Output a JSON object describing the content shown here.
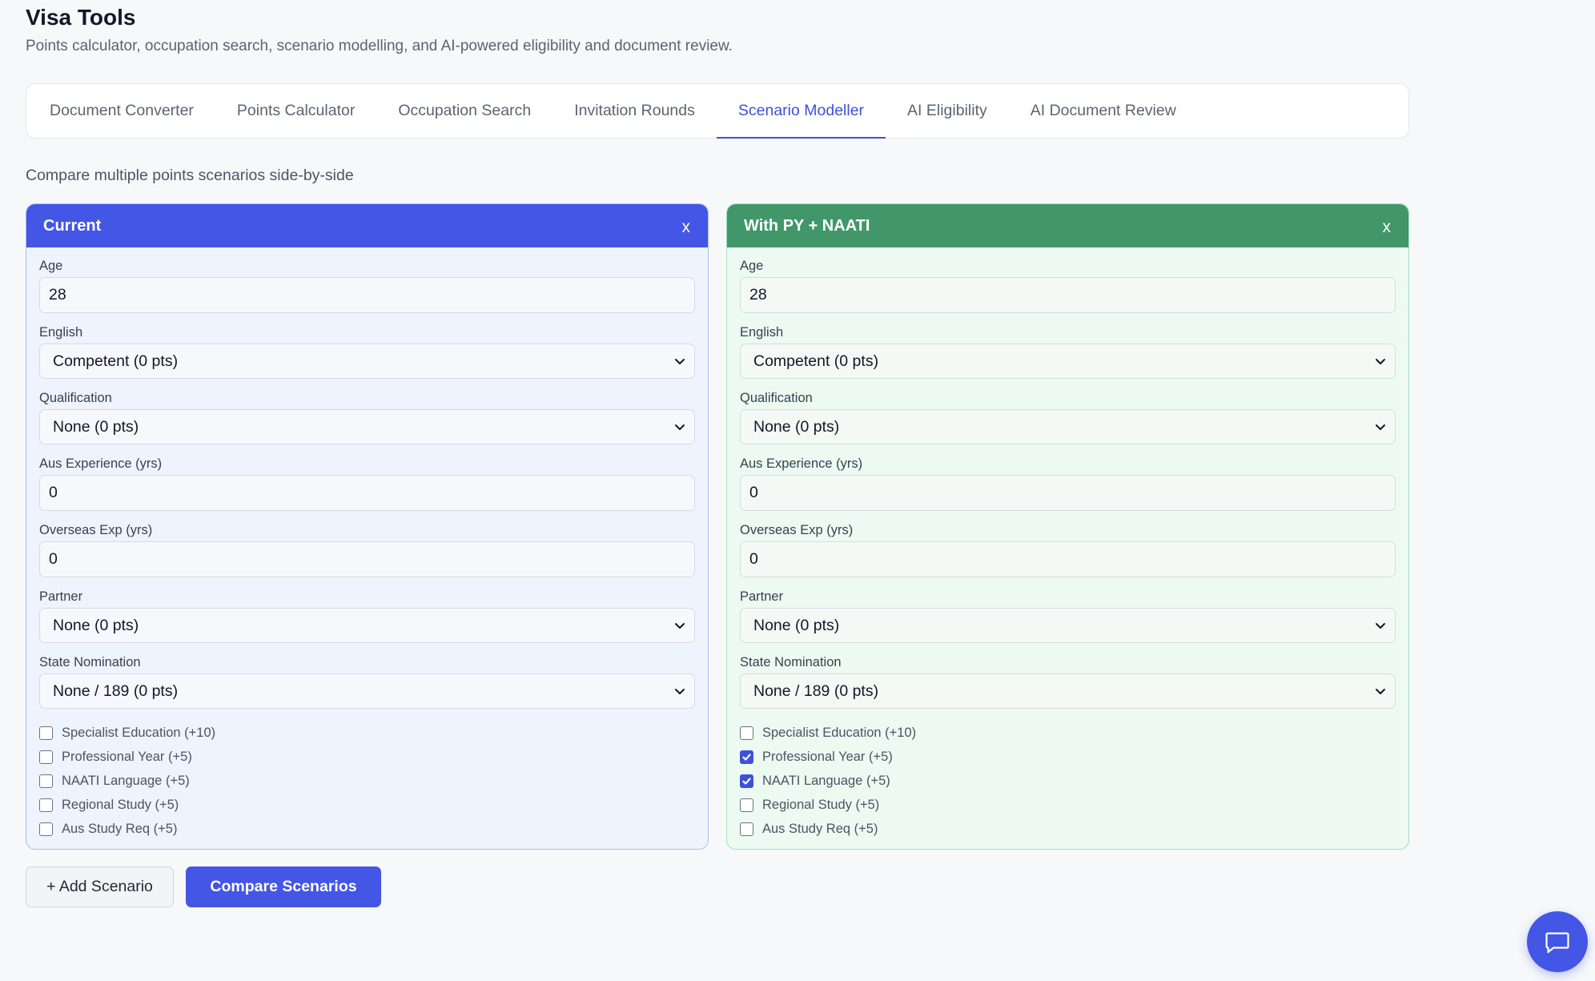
{
  "header": {
    "title": "Visa Tools",
    "subtitle": "Points calculator, occupation search, scenario modelling, and AI-powered eligibility and document review."
  },
  "tabs": [
    {
      "label": "Document Converter"
    },
    {
      "label": "Points Calculator"
    },
    {
      "label": "Occupation Search"
    },
    {
      "label": "Invitation Rounds"
    },
    {
      "label": "Scenario Modeller",
      "active": true
    },
    {
      "label": "AI Eligibility"
    },
    {
      "label": "AI Document Review"
    }
  ],
  "section": {
    "description": "Compare multiple points scenarios side-by-side"
  },
  "labels": {
    "age": "Age",
    "english": "English",
    "qualification": "Qualification",
    "aus_experience": "Aus Experience (yrs)",
    "overseas_exp": "Overseas Exp (yrs)",
    "partner": "Partner",
    "state_nomination": "State Nomination"
  },
  "checkbox_labels": [
    "Specialist Education (+10)",
    "Professional Year (+5)",
    "NAATI Language (+5)",
    "Regional Study (+5)",
    "Aus Study Req (+5)"
  ],
  "scenarios": [
    {
      "name": "Current",
      "color": "#4356e6",
      "close_label": "x",
      "age": "28",
      "english": "Competent (0 pts)",
      "qualification": "None (0 pts)",
      "aus_experience": "0",
      "overseas_exp": "0",
      "partner": "None (0 pts)",
      "state_nomination": "None / 189 (0 pts)",
      "checks": [
        false,
        false,
        false,
        false,
        false
      ]
    },
    {
      "name": "With PY + NAATI",
      "color": "#41976a",
      "close_label": "x",
      "age": "28",
      "english": "Competent (0 pts)",
      "qualification": "None (0 pts)",
      "aus_experience": "0",
      "overseas_exp": "0",
      "partner": "None (0 pts)",
      "state_nomination": "None / 189 (0 pts)",
      "checks": [
        false,
        true,
        true,
        false,
        false
      ]
    }
  ],
  "actions": {
    "add_label": "+ Add Scenario",
    "compare_label": "Compare Scenarios"
  },
  "icons": {
    "chat": "chat-bubble-icon",
    "select": "chevron-down-icon",
    "check": "check-icon"
  },
  "colors": {
    "accent": "#4356e6",
    "green": "#41976a"
  }
}
